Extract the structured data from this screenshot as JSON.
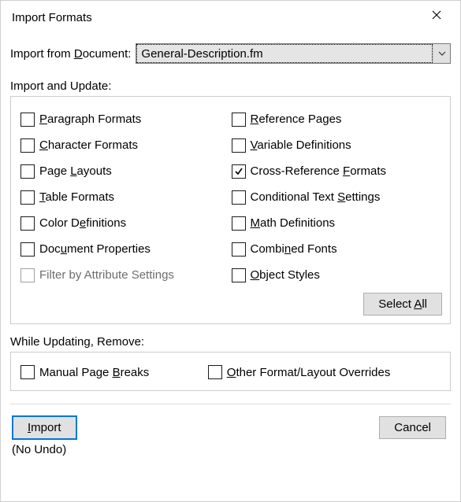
{
  "window": {
    "title": "Import Formats"
  },
  "importFrom": {
    "label_pre": "Import from ",
    "label_u": "D",
    "label_post": "ocument:",
    "value": "General-Description.fm"
  },
  "sections": {
    "importUpdate": "Import and Update:",
    "whileUpdating": "While Updating, Remove:"
  },
  "checks": {
    "left": [
      {
        "pre": "",
        "u": "P",
        "post": "aragraph Formats",
        "checked": false,
        "disabled": false,
        "name": "paragraph-formats"
      },
      {
        "pre": "",
        "u": "C",
        "post": "haracter Formats",
        "checked": false,
        "disabled": false,
        "name": "character-formats"
      },
      {
        "pre": "Page ",
        "u": "L",
        "post": "ayouts",
        "checked": false,
        "disabled": false,
        "name": "page-layouts"
      },
      {
        "pre": "",
        "u": "T",
        "post": "able Formats",
        "checked": false,
        "disabled": false,
        "name": "table-formats"
      },
      {
        "pre": "Color D",
        "u": "e",
        "post": "finitions",
        "checked": false,
        "disabled": false,
        "name": "color-definitions"
      },
      {
        "pre": "Doc",
        "u": "u",
        "post": "ment Properties",
        "checked": false,
        "disabled": false,
        "name": "document-properties"
      },
      {
        "pre": "Filter by Attribute Settings",
        "u": "",
        "post": "",
        "checked": false,
        "disabled": true,
        "name": "filter-by-attribute-settings"
      }
    ],
    "right": [
      {
        "pre": "",
        "u": "R",
        "post": "eference Pages",
        "checked": false,
        "disabled": false,
        "name": "reference-pages"
      },
      {
        "pre": "",
        "u": "V",
        "post": "ariable Definitions",
        "checked": false,
        "disabled": false,
        "name": "variable-definitions"
      },
      {
        "pre": "Cross-Reference ",
        "u": "F",
        "post": "ormats",
        "checked": true,
        "disabled": false,
        "name": "cross-reference-formats"
      },
      {
        "pre": "Conditional Text ",
        "u": "S",
        "post": "ettings",
        "checked": false,
        "disabled": false,
        "name": "conditional-text-settings"
      },
      {
        "pre": "",
        "u": "M",
        "post": "ath Definitions",
        "checked": false,
        "disabled": false,
        "name": "math-definitions"
      },
      {
        "pre": "Combi",
        "u": "n",
        "post": "ed Fonts",
        "checked": false,
        "disabled": false,
        "name": "combined-fonts"
      },
      {
        "pre": "",
        "u": "O",
        "post": "bject Styles",
        "checked": false,
        "disabled": false,
        "name": "object-styles"
      }
    ]
  },
  "remove": {
    "pageBreaks": {
      "pre": "Manual Page ",
      "u": "B",
      "post": "reaks",
      "checked": false
    },
    "other": {
      "pre": "",
      "u": "O",
      "post": "ther Format/Layout Overrides",
      "checked": false
    }
  },
  "buttons": {
    "selectAll": {
      "pre": "Select ",
      "u": "A",
      "post": "ll"
    },
    "import": {
      "pre": "",
      "u": "I",
      "post": "mport"
    },
    "cancel": "Cancel"
  },
  "noUndo": "(No Undo)"
}
